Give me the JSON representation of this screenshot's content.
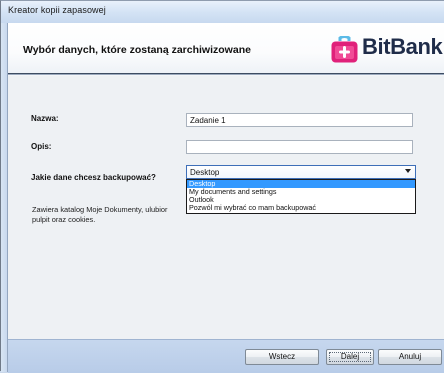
{
  "window": {
    "title": "Kreator kopii zapasowej"
  },
  "header": {
    "title": "Wybór danych, które zostaną zarchiwizowane",
    "logo_text": "BitBank",
    "logo_color": "#e0217a"
  },
  "form": {
    "name_label": "Nazwa:",
    "name_value": "Zadanie 1",
    "description_label": "Opis:",
    "description_value": "",
    "data_label": "Jakie dane chcesz backupować?",
    "data_selected": "Desktop",
    "data_options": [
      "Desktop",
      "My documents and settings",
      "Outlook",
      "Pozwól mi wybrać co mam backupować"
    ],
    "hint_lines": [
      "Zawiera katalog Moje Dokumenty, ulubior",
      "pulpit oraz cookies."
    ]
  },
  "buttons": {
    "back": "Wstecz",
    "next": "Dalej",
    "cancel": "Anuluj"
  },
  "colors": {
    "selection": "#3399ff",
    "footer": "#c6d7ee"
  }
}
